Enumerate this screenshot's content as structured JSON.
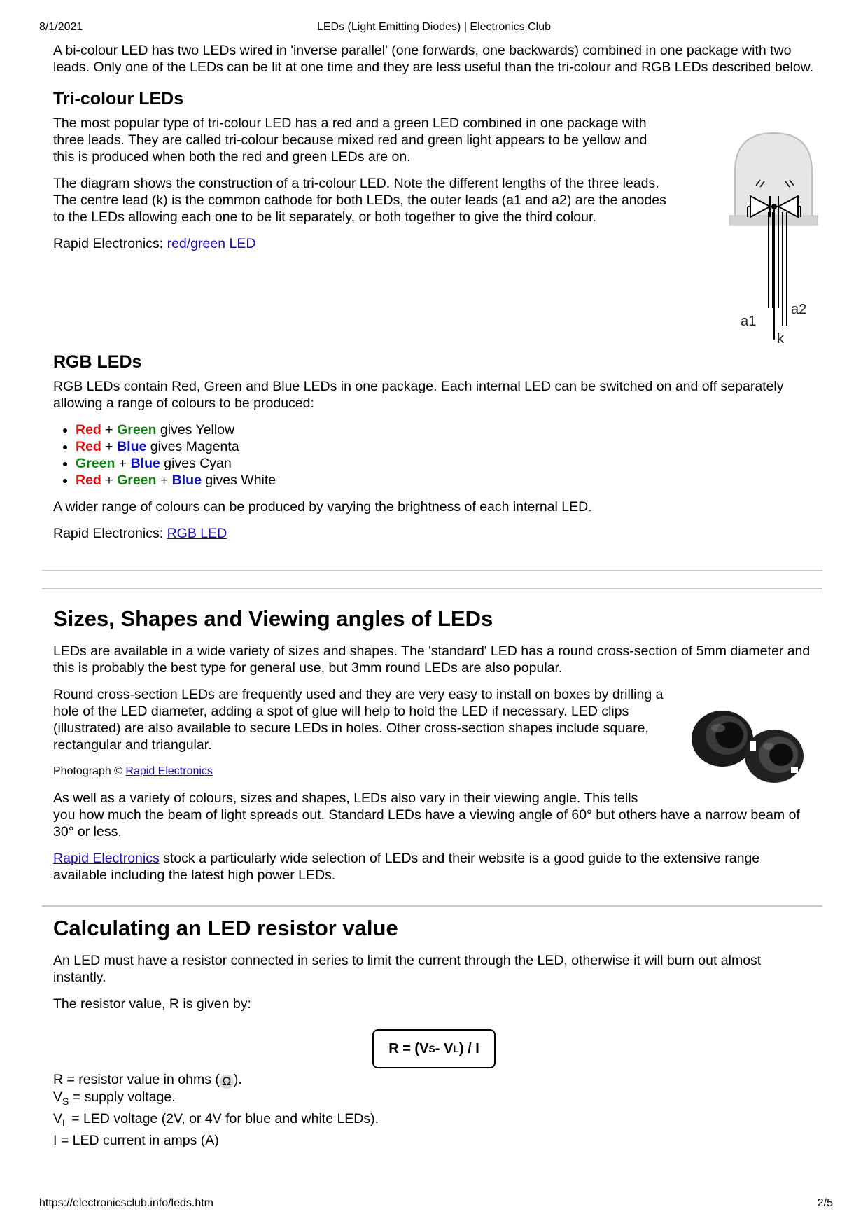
{
  "header": {
    "date": "8/1/2021",
    "title": "LEDs (Light Emitting Diodes) | Electronics Club"
  },
  "footer": {
    "url": "https://electronicsclub.info/leds.htm",
    "page": "2/5"
  },
  "bicolour": {
    "text": "A bi-colour LED has two LEDs wired in 'inverse parallel' (one forwards, one backwards) combined in one package with two leads. Only one of the LEDs can be lit at one time and they are less useful than the tri-colour and RGB LEDs described below."
  },
  "tricolour": {
    "heading": "Tri-colour LEDs",
    "p1": "The most popular type of tri-colour LED has a red and a green LED combined in one package with three leads. They are called tri-colour because mixed red and green light appears to be yellow and this is produced when both the red and green LEDs are on.",
    "p2": "The diagram shows the construction of a tri-colour LED. Note the different lengths of the three leads. The centre lead (k) is the common cathode for both LEDs, the outer leads (a1 and a2) are the anodes to the LEDs allowing each one to be lit separately, or both together to give the third colour.",
    "rapid_prefix": "Rapid Electronics: ",
    "rapid_link": "red/green LED",
    "diagram_labels": {
      "a1": "a1",
      "a2": "a2",
      "k": "k"
    }
  },
  "rgb": {
    "heading": "RGB LEDs",
    "p1": "RGB LEDs contain Red, Green and Blue LEDs in one package. Each internal LED can be switched on and off separately allowing a range of colours to be produced:",
    "items": [
      {
        "c1": "Red",
        "c2": "Green",
        "c3": "",
        "result": " gives Yellow"
      },
      {
        "c1": "Red",
        "c2": "Blue",
        "c3": "",
        "result": " gives Magenta"
      },
      {
        "c1": "Green",
        "c2": "Blue",
        "c3": "",
        "result": " gives Cyan"
      },
      {
        "c1": "Red",
        "c2": "Green",
        "c3": "Blue",
        "result": " gives White"
      }
    ],
    "plus": " + ",
    "p2": "A wider range of colours can be produced by varying the brightness of each internal LED.",
    "rapid_prefix": "Rapid Electronics: ",
    "rapid_link": "RGB LED",
    "colors": {
      "red": "#e01010",
      "green": "#108010",
      "blue": "#1010c0"
    }
  },
  "sizes": {
    "heading": "Sizes, Shapes and Viewing angles of LEDs",
    "p1": "LEDs are available in a wide variety of sizes and shapes. The 'standard' LED has a round cross-section of 5mm diameter and this is probably the best type for general use, but 3mm round LEDs are also popular.",
    "p2": "Round cross-section LEDs are frequently used and they are very easy to install on boxes by drilling a hole of the LED diameter, adding a spot of glue will help to hold the LED if necessary. LED clips (illustrated) are also available to secure LEDs in holes. Other cross-section shapes include square, rectangular and triangular.",
    "photo_prefix": "Photograph © ",
    "photo_link": "Rapid Electronics",
    "p3a": "As well as a variety of colours, sizes and shapes, LEDs also vary in their viewing angle. This tells",
    "p3b": "you how much the beam of light spreads out. Standard LEDs have a viewing angle of 60° but others have a narrow beam of 30° or less.",
    "p4_link": "Rapid Electronics",
    "p4_rest": " stock a particularly wide selection of LEDs and their website is a good guide to the extensive range available including the latest high power LEDs."
  },
  "resistor": {
    "heading": "Calculating an LED resistor value",
    "p1": "An LED must have a resistor connected in series to limit the current through the LED, otherwise it will burn out almost instantly.",
    "p2": "The resistor value, R is given by:",
    "formula": {
      "a": "R = (V",
      "s": "S",
      "b": " - V",
      "l": "L",
      "c": ") / I"
    },
    "defs": {
      "r_a": "R = resistor value in ohms (",
      "ohm": "Ω",
      "r_b": ").",
      "vs_v": "V",
      "vs_sub": "S",
      "vs_rest": " = supply voltage.",
      "vl_v": "V",
      "vl_sub": "L",
      "vl_rest": " = LED voltage (2V, or 4V for blue and white LEDs).",
      "i": "I = LED current in amps (A)"
    }
  }
}
